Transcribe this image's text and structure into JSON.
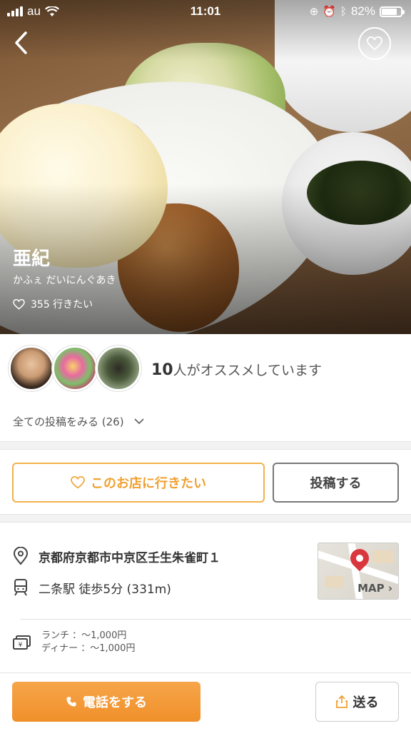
{
  "status_bar": {
    "carrier": "au",
    "time": "11:01",
    "battery": "82%",
    "battery_level": 0.82
  },
  "shop": {
    "name": "亜紀",
    "kana": "かふぇ だいにんぐあき",
    "want_count": "355 行きたい"
  },
  "recommend": {
    "count": "10",
    "text": "人がオススメしています",
    "see_all": "全ての投稿をみる (26)"
  },
  "actions": {
    "want_label": "このお店に行きたい",
    "post_label": "投稿する"
  },
  "info": {
    "address": "京都府京都市中京区壬生朱雀町１",
    "station": "二条駅 徒歩5分 (331m)",
    "map_label": "MAP",
    "price_lunch": "ランチ ：～1,000円",
    "price_dinner": "ディナー ：～1,000円"
  },
  "footer": {
    "call_label": "電話をする",
    "send_label": "送る"
  },
  "colors": {
    "accent_orange": "#f0a030",
    "call_orange": "#f0902a",
    "map_pin": "#d9363e"
  },
  "icons": [
    "back-chevron-icon",
    "heart-icon",
    "location-pin-icon",
    "train-icon",
    "yen-wallet-icon",
    "phone-icon",
    "share-icon",
    "chevron-down-icon",
    "wifi-icon",
    "bluetooth-icon",
    "alarm-icon"
  ]
}
